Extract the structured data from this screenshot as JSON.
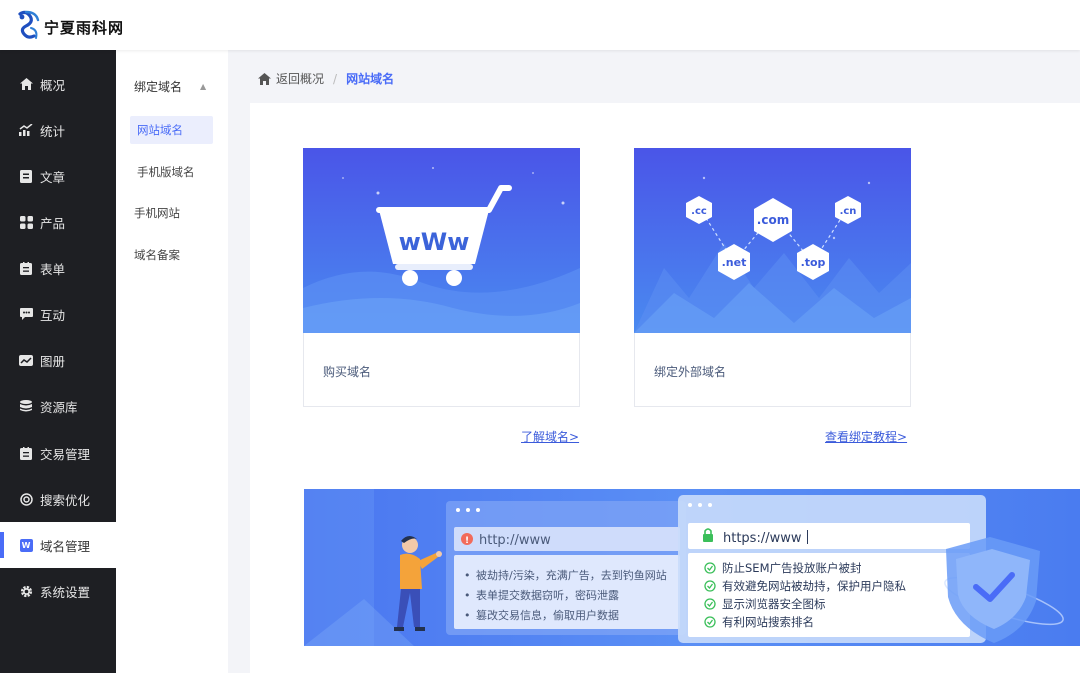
{
  "header": {
    "logo_text": "宁夏雨科网"
  },
  "sidebar": {
    "items": [
      {
        "label": "概况",
        "icon": "home-icon"
      },
      {
        "label": "统计",
        "icon": "chart-icon"
      },
      {
        "label": "文章",
        "icon": "article-icon"
      },
      {
        "label": "产品",
        "icon": "product-icon"
      },
      {
        "label": "表单",
        "icon": "form-icon"
      },
      {
        "label": "互动",
        "icon": "chat-icon"
      },
      {
        "label": "图册",
        "icon": "album-icon"
      },
      {
        "label": "资源库",
        "icon": "database-icon"
      },
      {
        "label": "交易管理",
        "icon": "trade-icon"
      },
      {
        "label": "搜索优化",
        "icon": "seo-icon"
      },
      {
        "label": "域名管理",
        "icon": "domain-icon",
        "badge": "W"
      },
      {
        "label": "系统设置",
        "icon": "gear-icon"
      }
    ]
  },
  "submenu": {
    "group_label": "绑定域名",
    "group_items": [
      "网站域名",
      "手机版域名"
    ],
    "items": [
      "手机网站",
      "域名备案"
    ]
  },
  "breadcrumb": {
    "back": "返回概况",
    "separator": "/",
    "current": "网站域名"
  },
  "cards": [
    {
      "label": "购买域名",
      "art_text": "wWw",
      "link": "了解域名>"
    },
    {
      "label": "绑定外部域名",
      "art_tags": [
        ".cc",
        ".com",
        ".cn",
        ".net",
        ".top"
      ],
      "link": "查看绑定教程>"
    }
  ],
  "banner": {
    "http_url": "http://www",
    "http_points": [
      "被劫持/污染，充满广告，去到钓鱼网站",
      "表单提交数据窃听，密码泄露",
      "篡改交易信息，偷取用户数据"
    ],
    "https_url": "https://www",
    "https_points": [
      "防止SEM广告投放账户被封",
      "有效避免网站被劫持，保护用户隐私",
      "显示浏览器安全图标",
      "有利网站搜索排名"
    ]
  },
  "colors": {
    "accent": "#4a6cf7",
    "sidebar_bg": "#1e1f23",
    "link": "#3b5bdb"
  }
}
